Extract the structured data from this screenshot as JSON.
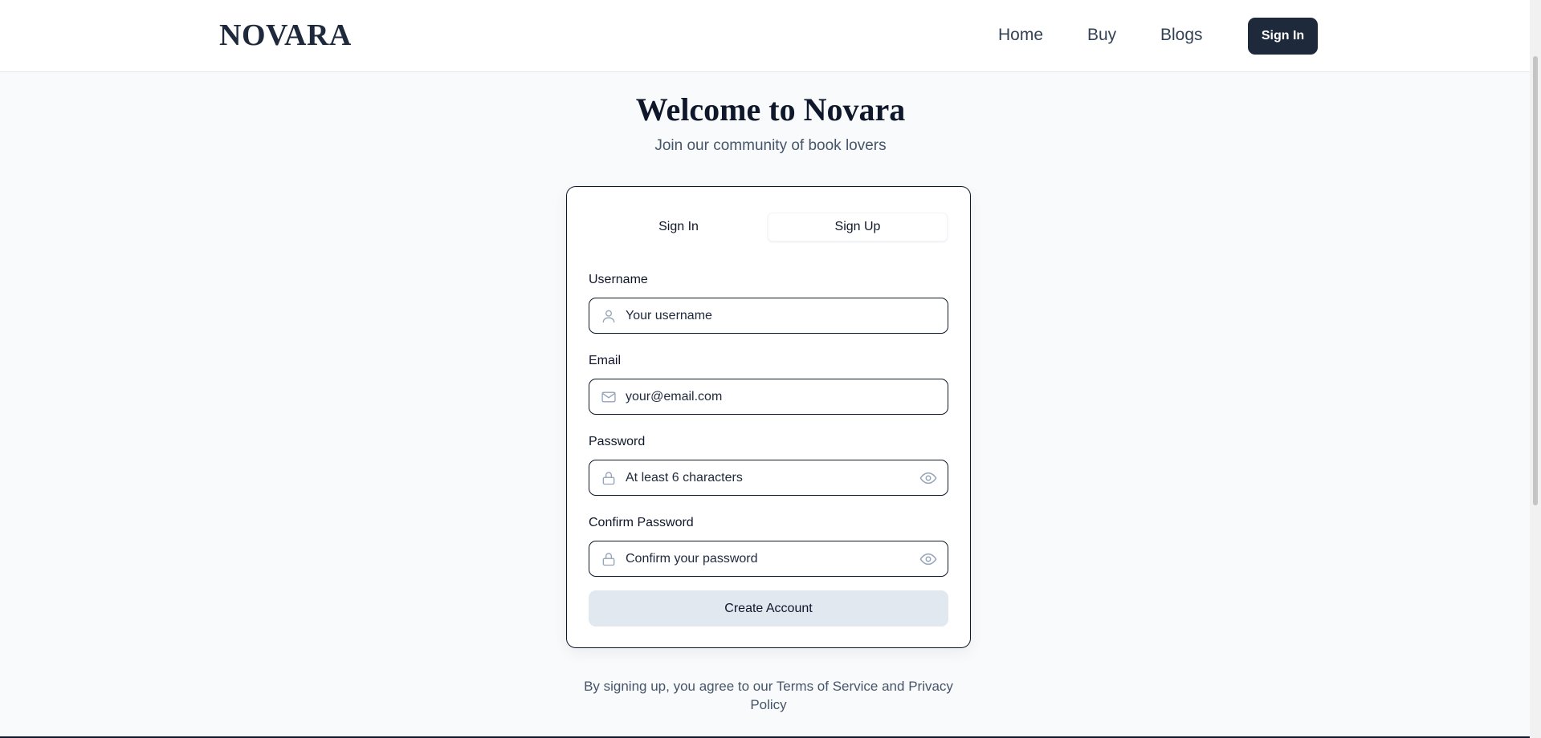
{
  "navbar": {
    "brand": "NOVARA",
    "links": {
      "home": "Home",
      "buy": "Buy",
      "blogs": "Blogs"
    },
    "signin_label": "Sign In"
  },
  "hero": {
    "title": "Welcome to Novara",
    "subtitle": "Join our community of book lovers"
  },
  "auth_card": {
    "tabs": {
      "signin": "Sign In",
      "signup": "Sign Up",
      "active": "Sign Up"
    },
    "fields": {
      "username": {
        "label": "Username",
        "placeholder": "Your username",
        "icon": "user-icon"
      },
      "email": {
        "label": "Email",
        "placeholder": "your@email.com",
        "icon": "mail-icon"
      },
      "password": {
        "label": "Password",
        "placeholder": "At least 6 characters",
        "icon": "lock-icon",
        "toggle_icon": "eye-icon"
      },
      "confirm_password": {
        "label": "Confirm Password",
        "placeholder": "Confirm your password",
        "icon": "lock-icon",
        "toggle_icon": "eye-icon"
      }
    },
    "submit_label": "Create Account"
  },
  "footer": {
    "note": "By signing up, you agree to our Terms of Service and Privacy Policy"
  },
  "colors": {
    "page_bg": "#f8fafc",
    "primary_dark": "#1e293b",
    "button_secondary": "#e2e8f0",
    "icon_muted": "#94a3b8",
    "text_muted": "#475569"
  }
}
